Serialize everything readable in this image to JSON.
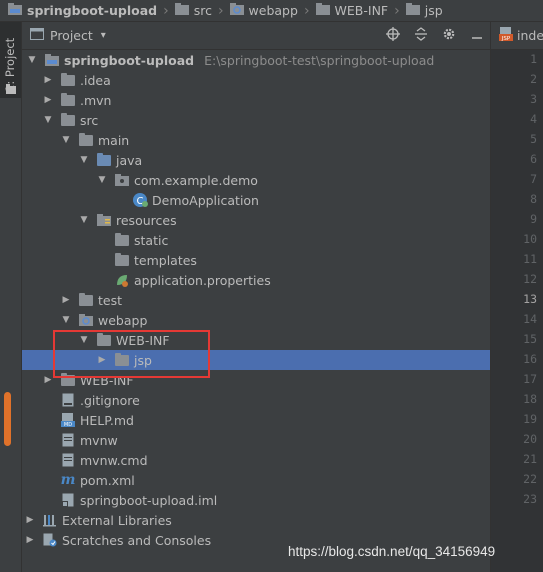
{
  "breadcrumb": [
    "springboot-upload",
    "src",
    "webapp",
    "WEB-INF",
    "jsp"
  ],
  "side_tab": {
    "label": "1: Project"
  },
  "panel": {
    "title": "Project",
    "dropdown": "▾"
  },
  "tree": [
    {
      "label": "springboot-upload",
      "path": "E:\\springboot-test\\springboot-upload"
    },
    {
      "label": ".idea"
    },
    {
      "label": ".mvn"
    },
    {
      "label": "src"
    },
    {
      "label": "main"
    },
    {
      "label": "java"
    },
    {
      "label": "com.example.demo"
    },
    {
      "label": "DemoApplication"
    },
    {
      "label": "resources"
    },
    {
      "label": "static"
    },
    {
      "label": "templates"
    },
    {
      "label": "application.properties"
    },
    {
      "label": "test"
    },
    {
      "label": "webapp"
    },
    {
      "label": "WEB-INF"
    },
    {
      "label": "jsp"
    },
    {
      "label": "WEB-INF"
    },
    {
      "label": ".gitignore"
    },
    {
      "label": "HELP.md"
    },
    {
      "label": "mvnw"
    },
    {
      "label": "mvnw.cmd"
    },
    {
      "label": "pom.xml"
    },
    {
      "label": "springboot-upload.iml"
    },
    {
      "label": "External Libraries"
    },
    {
      "label": "Scratches and Consoles"
    }
  ],
  "editor": {
    "tab_label": "inde",
    "line_numbers": [
      "1",
      "2",
      "3",
      "4",
      "5",
      "6",
      "7",
      "8",
      "9",
      "10",
      "11",
      "12",
      "13",
      "14",
      "15",
      "16",
      "17",
      "18",
      "19",
      "20",
      "21",
      "22",
      "23"
    ]
  },
  "watermark": "https://blog.csdn.net/qq_34156949",
  "colors": {
    "selection": "#4b6eaf",
    "highlight_box": "#e53935",
    "scroll_thumb": "#e0722a"
  }
}
